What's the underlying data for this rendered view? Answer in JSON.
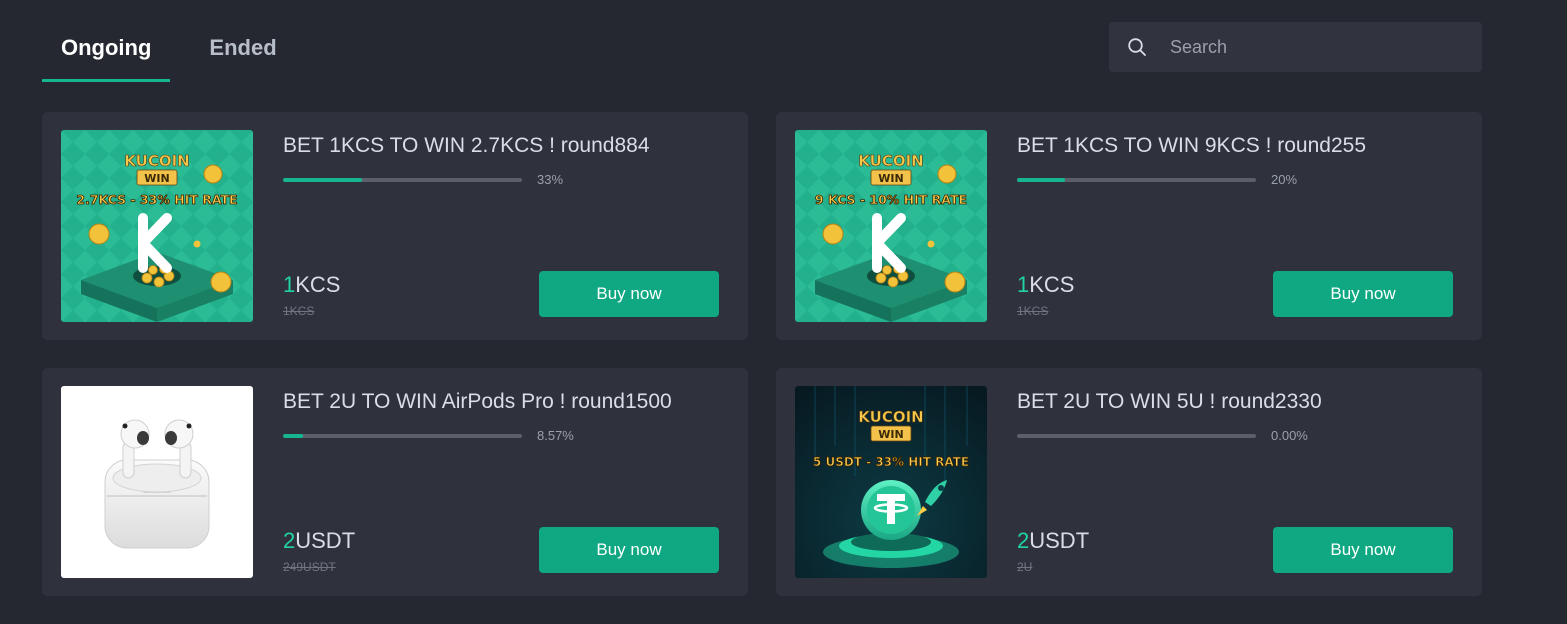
{
  "tabs": [
    "Ongoing",
    "Ended"
  ],
  "search": {
    "placeholder": "Search"
  },
  "colors": {
    "accent": "#14b58f",
    "button": "#0fa882",
    "background": "#252830",
    "card": "#2f323c"
  },
  "cards": [
    {
      "title": "BET 1KCS TO WIN 2.7KCS ! round884",
      "progress": 0.33,
      "progress_text": "33%",
      "price_num": "1",
      "price_unit": "KCS",
      "original_price": "1KCS",
      "button": "Buy now",
      "image": {
        "kind": "kucoin-green",
        "brand": "KUCOIN",
        "sub": "WIN",
        "caption": "2.7KCS - 33% HIT RATE"
      }
    },
    {
      "title": "BET 1KCS TO WIN 9KCS ! round255",
      "progress": 0.2,
      "progress_text": "20%",
      "price_num": "1",
      "price_unit": "KCS",
      "original_price": "1KCS",
      "button": "Buy now",
      "image": {
        "kind": "kucoin-green",
        "brand": "KUCOIN",
        "sub": "WIN",
        "caption": "9 KCS - 10% HIT RATE"
      }
    },
    {
      "title": "BET 2U TO WIN AirPods Pro ! round1500",
      "progress": 0.0857,
      "progress_text": "8.57%",
      "price_num": "2",
      "price_unit": "USDT",
      "original_price": "249USDT",
      "button": "Buy now",
      "image": {
        "kind": "airpods"
      }
    },
    {
      "title": "BET 2U TO WIN 5U ! round2330",
      "progress": 0,
      "progress_text": "0.00%",
      "price_num": "2",
      "price_unit": "USDT",
      "original_price": "2U",
      "button": "Buy now",
      "image": {
        "kind": "kucoin-dark",
        "brand": "KUCOIN",
        "sub": "WIN",
        "caption": "5 USDT - 33% HIT RATE"
      }
    }
  ]
}
